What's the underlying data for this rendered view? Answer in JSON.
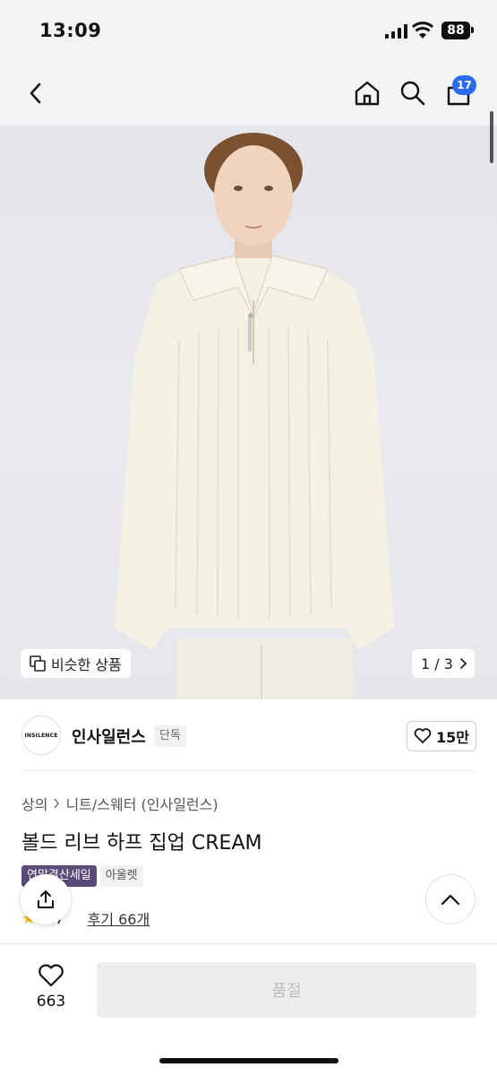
{
  "status_bar": {
    "time": "13:09",
    "battery": "88"
  },
  "nav": {
    "cart_count": "17",
    "icons": [
      "back-arrow-icon",
      "home-icon",
      "search-icon",
      "cart-icon"
    ]
  },
  "gallery": {
    "similar_label": "비슷한 상품",
    "page": "1 / 3"
  },
  "brand": {
    "logo_text": "INSILENCE",
    "name": "인사일런스",
    "tag": "단독",
    "likes": "15만"
  },
  "product": {
    "breadcrumb": [
      "상의",
      "니트/스웨터 (인사일런스)"
    ],
    "title": "볼드 리브 하프 집업 CREAM",
    "badges": {
      "sale": "연말결산세일",
      "outlet": "아울렛"
    },
    "rating": "4.7",
    "reviews": "후기 66개"
  },
  "bottom_bar": {
    "wish_count": "663",
    "soldout_label": "품절"
  },
  "colors": {
    "accent": "#2b6bf0",
    "sale_badge": "#5a4a78",
    "star": "#f5b400"
  }
}
